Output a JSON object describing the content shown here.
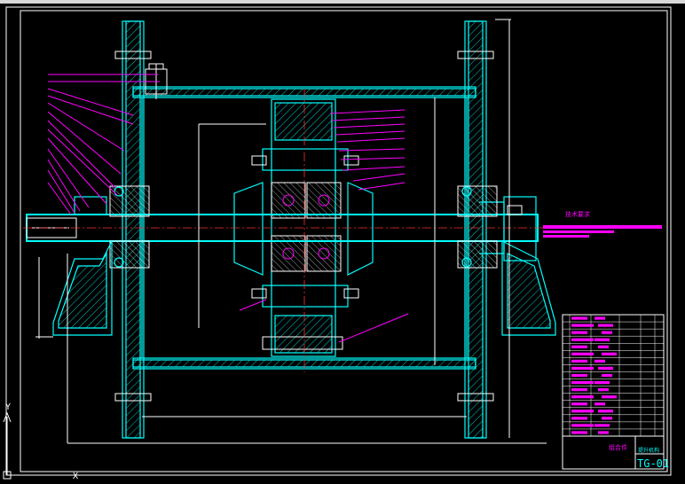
{
  "drawing": {
    "tech_requirements_title": "技术要求",
    "title_block": {
      "part_name": "提升机构",
      "material": "组合件",
      "drawing_no": "TG-01"
    }
  },
  "ucs": {
    "x_label": "X",
    "y_label": "Y"
  },
  "colors": {
    "background": "#000000",
    "outline": "#00ffff",
    "edges": "#ffffff",
    "leaders": "#ff00ff",
    "centerline": "#ff3030"
  }
}
